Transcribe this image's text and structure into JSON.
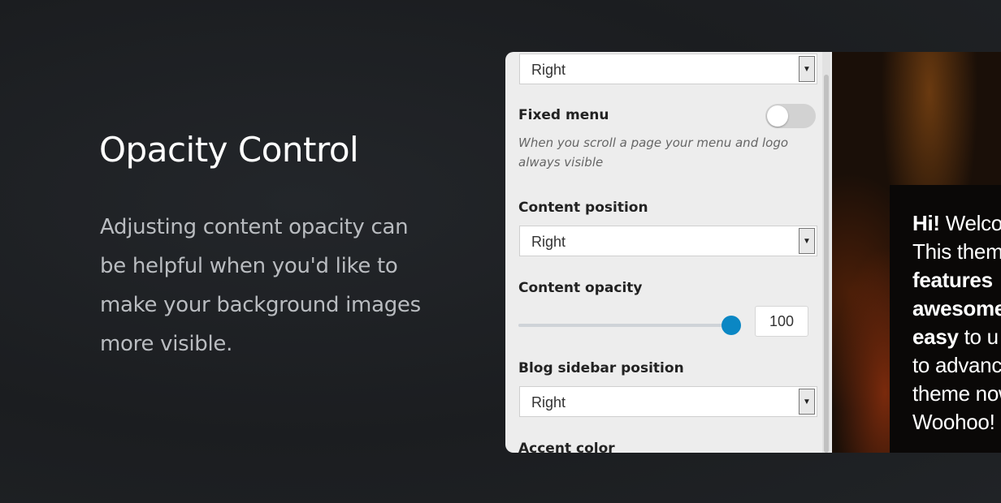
{
  "hero": {
    "title": "Opacity Control",
    "description": "Adjusting content opacity can be helpful when you'd like to make your background images more visible."
  },
  "panel": {
    "top_select": {
      "value": "Right"
    },
    "fixed_menu": {
      "label": "Fixed menu",
      "enabled": false,
      "hint": "When you scroll a page your menu and logo always visible"
    },
    "content_position": {
      "label": "Content position",
      "value": "Right"
    },
    "content_opacity": {
      "label": "Content opacity",
      "value": "100",
      "fraction": 1.0
    },
    "blog_sidebar_position": {
      "label": "Blog sidebar position",
      "value": "Right"
    },
    "accent_color": {
      "label": "Accent color"
    }
  },
  "preview": {
    "lines": [
      {
        "bold": "Hi!",
        "text": " Welco"
      },
      {
        "bold": "",
        "text": "This  them"
      },
      {
        "bold": "features",
        "text": ""
      },
      {
        "bold": "awesome",
        "text": ""
      },
      {
        "bold": "easy",
        "text": "  to  u"
      },
      {
        "bold": "",
        "text": "to advanc"
      },
      {
        "bold": "",
        "text": "theme now"
      },
      {
        "bold": "",
        "text": "Woohoo!"
      }
    ]
  },
  "colors": {
    "background": "#1e2023",
    "accent": "#0b87c4",
    "panel": "#ededed"
  },
  "icons": {
    "select_arrow": "triangle-down-icon"
  }
}
